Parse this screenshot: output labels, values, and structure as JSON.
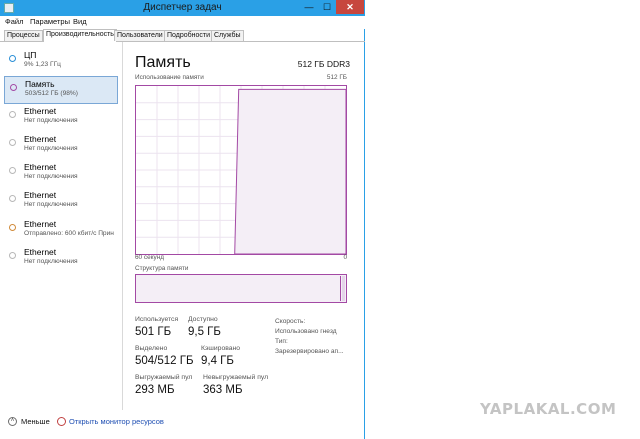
{
  "window": {
    "title": "Диспетчер задач",
    "minimize": "—",
    "maximize": "☐",
    "close": "✕"
  },
  "menu": [
    "Файл",
    "Параметры",
    "Вид"
  ],
  "tabs": [
    "Процессы",
    "Производительность",
    "Пользователи",
    "Подробности",
    "Службы"
  ],
  "active_tab": "Производительность",
  "sidebar": {
    "items": [
      {
        "name": "ЦП",
        "sub": "9% 1,23 ГГц",
        "color": "#2b8fd6",
        "selected": false
      },
      {
        "name": "Память",
        "sub": "503/512 ГБ (98%)",
        "color": "#a349a4",
        "selected": true
      },
      {
        "name": "Ethernet",
        "sub": "Нет подключения",
        "color": "#b8b8b8",
        "selected": false
      },
      {
        "name": "Ethernet",
        "sub": "Нет подключения",
        "color": "#b8b8b8",
        "selected": false
      },
      {
        "name": "Ethernet",
        "sub": "Нет подключения",
        "color": "#b8b8b8",
        "selected": false
      },
      {
        "name": "Ethernet",
        "sub": "Нет подключения",
        "color": "#b8b8b8",
        "selected": false
      },
      {
        "name": "Ethernet",
        "sub": "Отправлено: 600 кбит/с Прин",
        "color": "#d08a3a",
        "selected": false
      },
      {
        "name": "Ethernet",
        "sub": "Нет подключения",
        "color": "#b8b8b8",
        "selected": false
      }
    ]
  },
  "main": {
    "title": "Память",
    "spec": "512 ГБ DDR3",
    "usage_label": "Использование памяти",
    "usage_max": "512 ГБ",
    "time_left": "60 секунд",
    "time_right": "0",
    "structure_label": "Структура памяти",
    "stats": {
      "in_use_label": "Используется",
      "in_use": "501 ГБ",
      "available_label": "Доступно",
      "available": "9,5 ГБ",
      "committed_label": "Выделено",
      "committed": "504/512 ГБ",
      "cached_label": "Кэшировано",
      "cached": "9,4 ГБ",
      "paged_label": "Выгружаемый пул",
      "paged": "293 МБ",
      "nonpaged_label": "Невыгружаемый пул",
      "nonpaged": "363 МБ"
    },
    "right_labels": {
      "speed": "Скорость:",
      "slots": "Использовано гнезд",
      "form": "Тип:",
      "reserved": "Зарезервировано ап..."
    },
    "usage_fraction": 0.98,
    "accent": "#a349a4"
  },
  "bottom": {
    "less": "Меньше",
    "resmon": "Открыть монитор ресурсов"
  },
  "watermark": "YAPLAKAL.COM"
}
